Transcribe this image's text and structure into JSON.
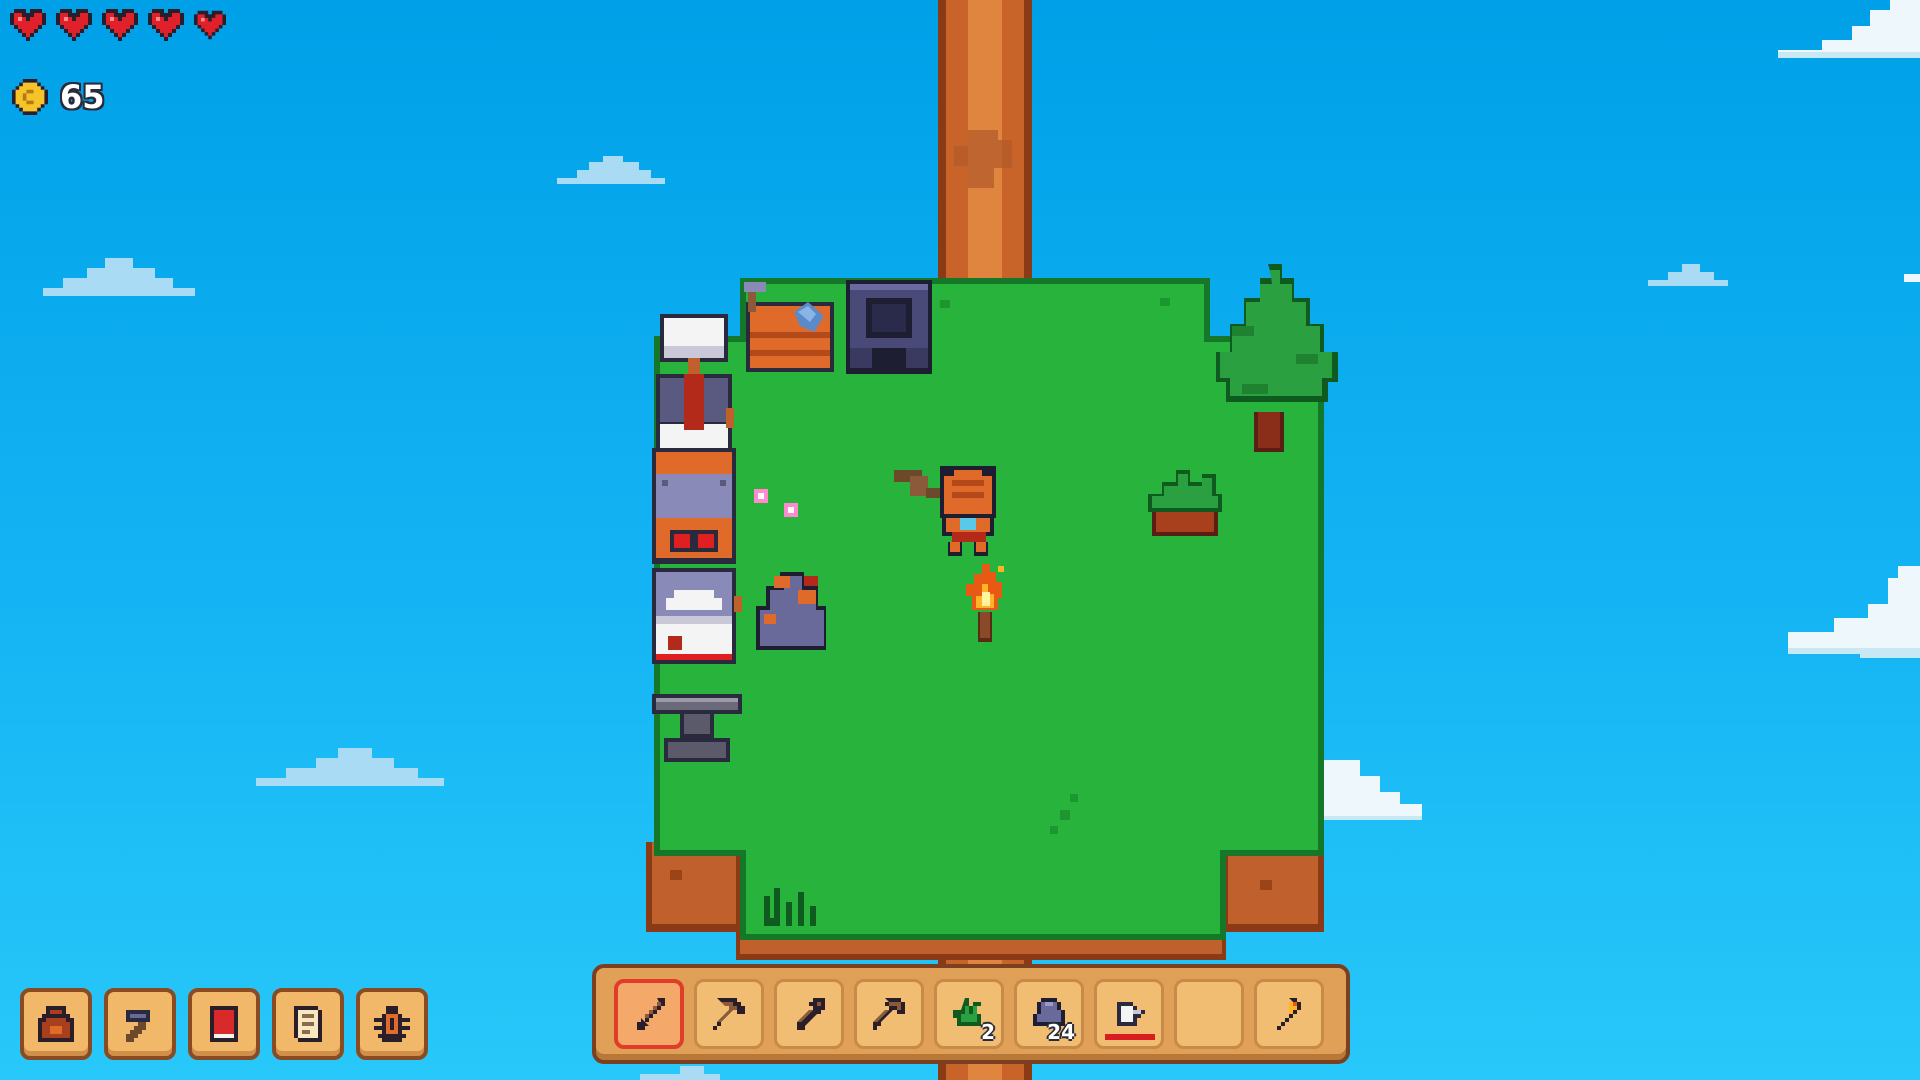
{
  "hud": {
    "health": {
      "hearts_full": 5,
      "hearts_total": 5
    },
    "coins": {
      "icon": "coin-icon",
      "count": "65"
    }
  },
  "menu_buttons": [
    {
      "id": "inventory",
      "icon": "backpack-icon"
    },
    {
      "id": "build",
      "icon": "hammer-icon"
    },
    {
      "id": "book",
      "icon": "book-icon"
    },
    {
      "id": "quests",
      "icon": "scroll-icon"
    },
    {
      "id": "bugs",
      "icon": "bug-icon"
    }
  ],
  "hotbar": {
    "selected_index": 0,
    "slots": [
      {
        "item": "sword-icon",
        "count": ""
      },
      {
        "item": "pickaxe-icon",
        "count": ""
      },
      {
        "item": "shovel-icon",
        "count": ""
      },
      {
        "item": "axe-icon",
        "count": ""
      },
      {
        "item": "seeds-icon",
        "count": "2"
      },
      {
        "item": "stone-icon",
        "count": "24"
      },
      {
        "item": "watering-can-icon",
        "count": "",
        "durability": 1.0
      },
      {
        "item": "",
        "count": ""
      },
      {
        "item": "torch-icon",
        "count": ""
      }
    ]
  },
  "world": {
    "structures": [
      "furnace",
      "workbench",
      "forge",
      "sawmill",
      "anvil",
      "sewing-station",
      "cooking-pot"
    ],
    "objects": [
      "pine-tree",
      "berry-bush",
      "campfire",
      "iron-ore-rock",
      "grass-tuft",
      "flowers"
    ],
    "player": "player-character"
  },
  "colors": {
    "sky_top": "#00a0e8",
    "grass": "#28b43c",
    "grass_border": "#147828",
    "dirt": "#b4582a"
  }
}
